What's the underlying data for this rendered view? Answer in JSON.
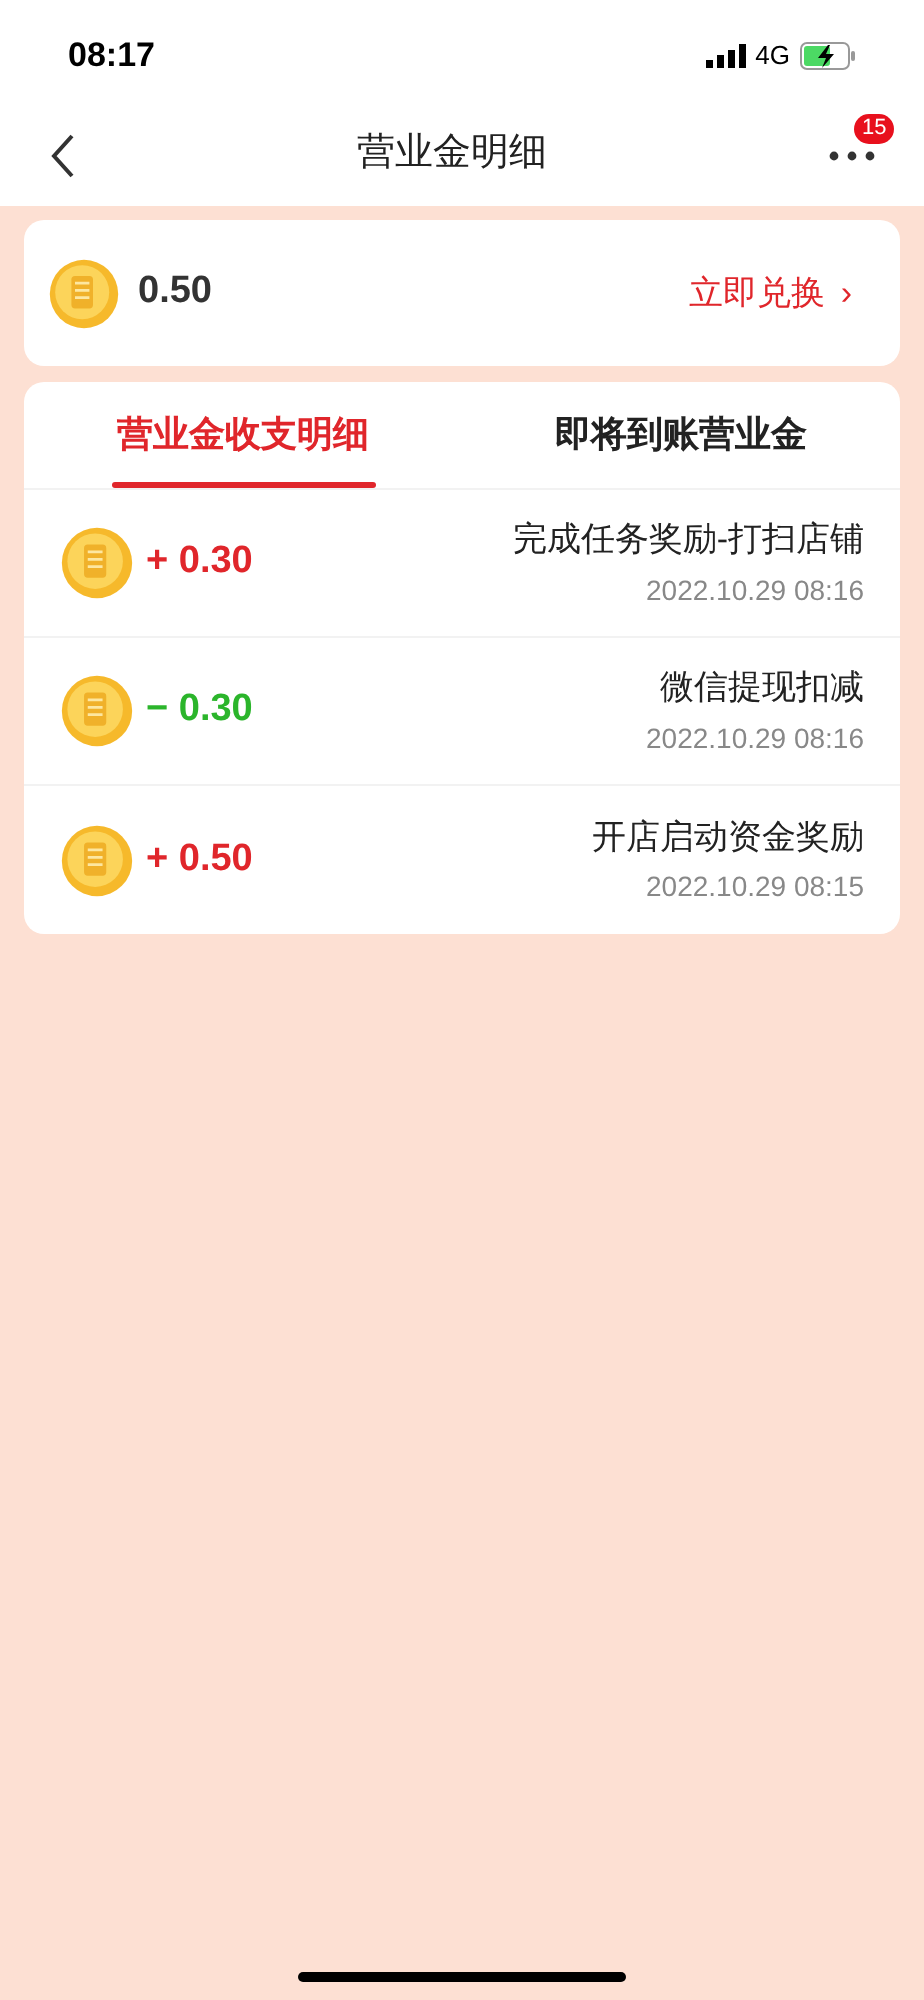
{
  "status_bar": {
    "time": "08:17",
    "network": "4G"
  },
  "nav": {
    "title": "营业金明细",
    "badge": "15"
  },
  "balance": {
    "amount": "0.50",
    "action": "立即兑换",
    "action_arrow": "›"
  },
  "tabs": [
    {
      "label": "营业金收支明细",
      "selected": true
    },
    {
      "label": "即将到账营业金",
      "selected": false
    }
  ],
  "records": [
    {
      "kind": "income",
      "amount": "+ 0.30",
      "title": "完成任务奖励-打扫店铺",
      "time": "2022.10.29 08:16"
    },
    {
      "kind": "expense",
      "amount": "− 0.30",
      "title": "微信提现扣减",
      "time": "2022.10.29 08:16"
    },
    {
      "kind": "income",
      "amount": "+ 0.50",
      "title": "开店启动资金奖励",
      "time": "2022.10.29 08:15"
    }
  ]
}
